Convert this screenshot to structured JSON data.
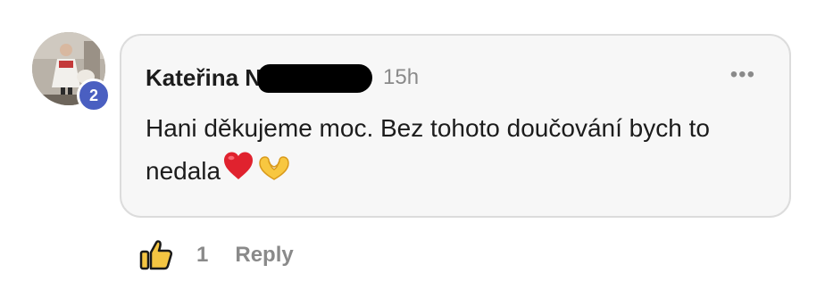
{
  "comment": {
    "author_name": "Kateřina N",
    "timestamp": "15h",
    "more_menu_glyph": "•••",
    "text": "Hani děkujeme moc. Bez tohoto doučování bych to nedala",
    "emojis": [
      "red-heart-emoji",
      "heart-hands-emoji"
    ]
  },
  "avatar": {
    "badge_count": "2"
  },
  "actions": {
    "like_count": "1",
    "reply_label": "Reply"
  },
  "colors": {
    "bubble_background": "#f7f7f7",
    "bubble_border": "#dcdcdc",
    "badge": "#4a5fc1",
    "muted_text": "#8a8a8a",
    "like_icon_fill": "#f4c542"
  }
}
